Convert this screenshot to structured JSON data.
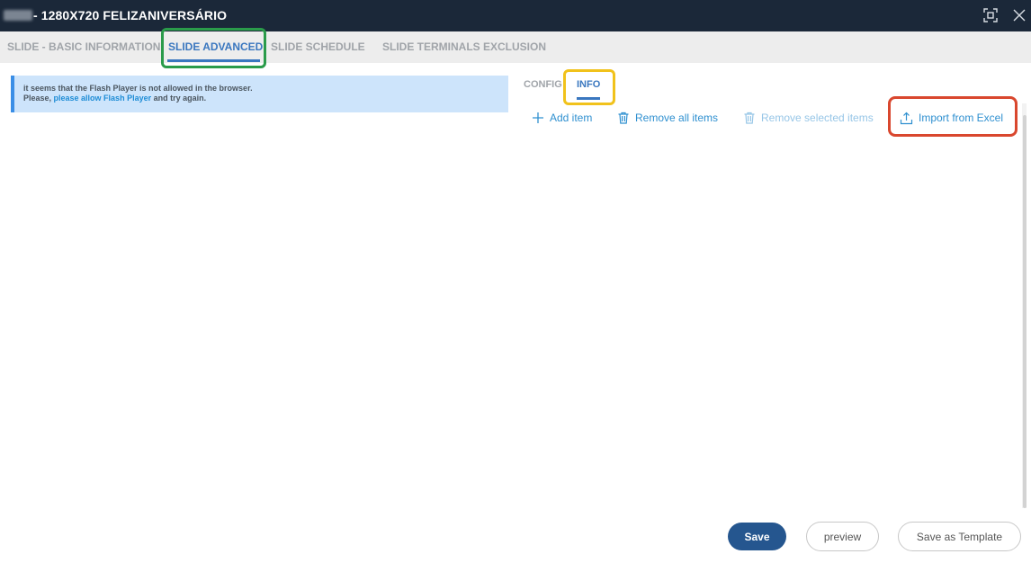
{
  "window": {
    "title": "- 1280X720 FELIZANIVERSÁRIO"
  },
  "main_tabs": [
    {
      "label": "SLIDE - BASIC INFORMATION",
      "active": false
    },
    {
      "label": "SLIDE ADVANCED",
      "active": true
    },
    {
      "label": "SLIDE SCHEDULE",
      "active": false
    },
    {
      "label": "SLIDE TERMINALS EXCLUSION",
      "active": false
    }
  ],
  "flash_notice": {
    "line1": "it seems that the Flash Player is not allowed in the browser.",
    "line2_prefix": "Please, ",
    "line2_link": "please allow Flash Player",
    "line2_suffix": " and try again."
  },
  "sub_tabs": [
    {
      "label": "CONFIG",
      "active": false
    },
    {
      "label": "INFO",
      "active": true
    }
  ],
  "actions": {
    "add_item": "Add item",
    "remove_all": "Remove all items",
    "remove_selected": "Remove selected items",
    "import_excel": "Import from Excel"
  },
  "buttons": {
    "save": "Save",
    "preview": "preview",
    "save_template": "Save as Template"
  },
  "colors": {
    "titlebar": "#1b2839",
    "accent": "#3a77bf",
    "link": "#2f90d0",
    "save_button": "#25568f",
    "highlight_green": "#2a9b4a",
    "highlight_yellow": "#f1c21b",
    "highlight_red": "#d9472e"
  },
  "icons": [
    "maximize-icon",
    "close-icon",
    "plus-icon",
    "trash-icon",
    "upload-icon"
  ]
}
